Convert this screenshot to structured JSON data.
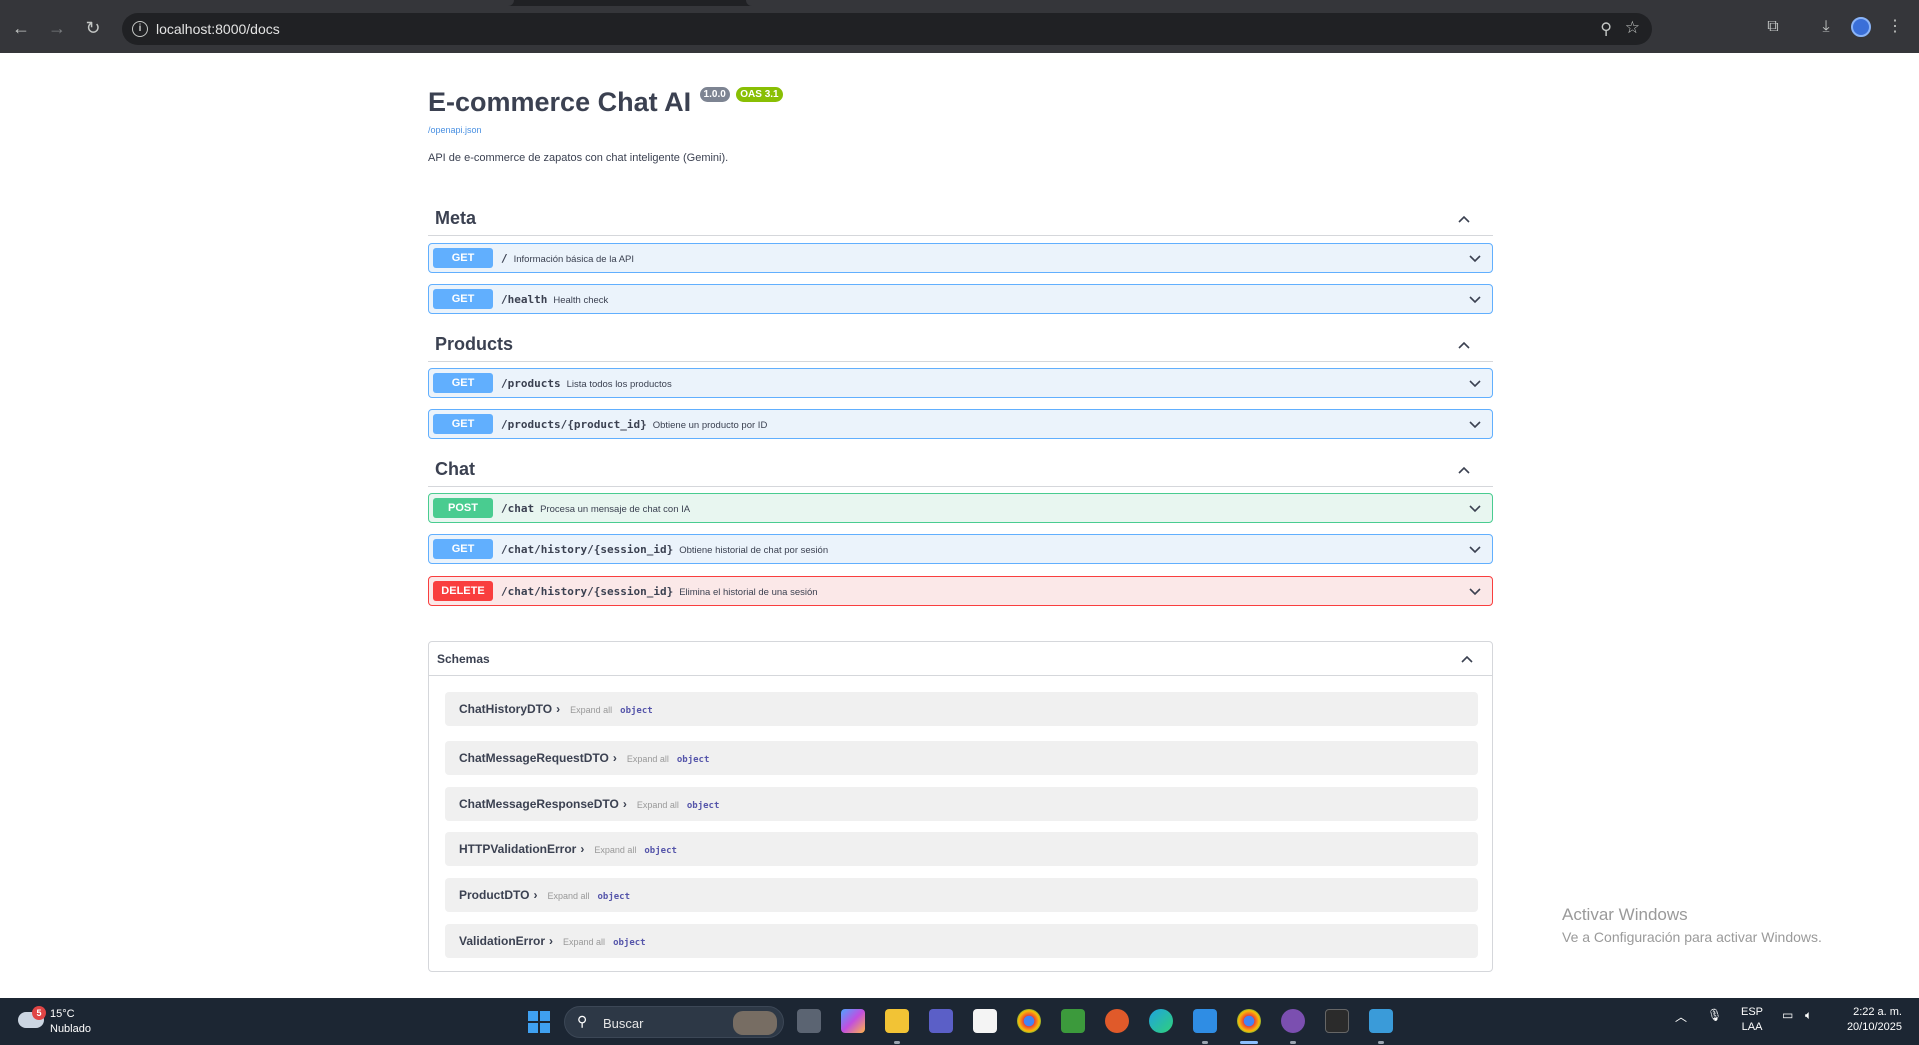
{
  "browser": {
    "url": "localhost:8000/docs"
  },
  "api": {
    "title": "E-commerce Chat AI",
    "version": "1.0.0",
    "oas": "OAS 3.1",
    "openapi_link": "/openapi.json",
    "description": "API de e-commerce de zapatos con chat inteligente (Gemini)."
  },
  "tags": [
    {
      "name": "Meta",
      "operations": [
        {
          "method": "GET",
          "path": "/",
          "summary": "Información básica de la API"
        },
        {
          "method": "GET",
          "path": "/health",
          "summary": "Health check"
        }
      ]
    },
    {
      "name": "Products",
      "operations": [
        {
          "method": "GET",
          "path": "/products",
          "summary": "Lista todos los productos"
        },
        {
          "method": "GET",
          "path": "/products/{product_id}",
          "summary": "Obtiene un producto por ID"
        }
      ]
    },
    {
      "name": "Chat",
      "operations": [
        {
          "method": "POST",
          "path": "/chat",
          "summary": "Procesa un mensaje de chat con IA"
        },
        {
          "method": "GET",
          "path": "/chat/history/{session_id}",
          "summary": "Obtiene historial de chat por sesión"
        },
        {
          "method": "DELETE",
          "path": "/chat/history/{session_id}",
          "summary": "Elimina el historial de una sesión"
        }
      ]
    }
  ],
  "schemas": {
    "title": "Schemas",
    "expand_label": "Expand all",
    "type_label": "object",
    "models": [
      {
        "name": "ChatHistoryDTO"
      },
      {
        "name": "ChatMessageRequestDTO"
      },
      {
        "name": "ChatMessageResponseDTO"
      },
      {
        "name": "HTTPValidationError"
      },
      {
        "name": "ProductDTO"
      },
      {
        "name": "ValidationError"
      }
    ]
  },
  "watermark": {
    "line1": "Activar Windows",
    "line2": "Ve a Configuración para activar Windows."
  },
  "taskbar": {
    "weather_badge": "5",
    "temperature": "15°C",
    "condition": "Nublado",
    "search_label": "Buscar",
    "language_line1": "ESP",
    "language_line2": "LAA",
    "time": "2:22 a. m.",
    "date": "20/10/2025"
  },
  "colors": {
    "get": "#61affe",
    "post": "#49cc90",
    "delete": "#f93e3e",
    "oas_badge": "#89bf04",
    "version_badge": "#7d8492"
  }
}
